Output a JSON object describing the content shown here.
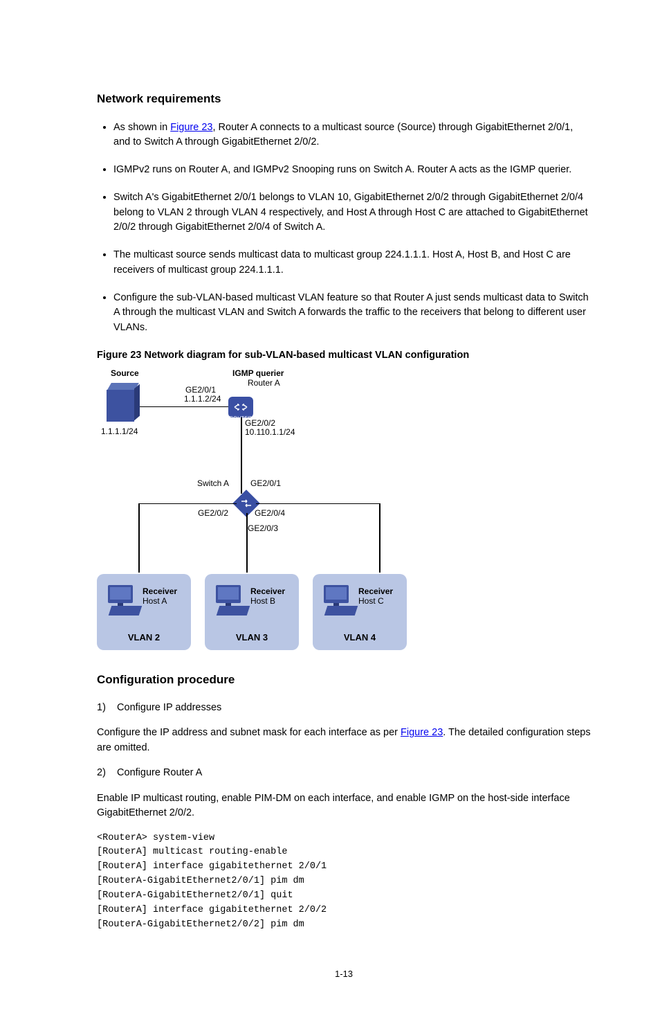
{
  "section1": {
    "title": "Network requirements",
    "bullets": [
      {
        "pre": "As shown in ",
        "link": "Figure 23",
        "post": ", Router A connects to a multicast source (Source) through GigabitEthernet 2/0/1, and to Switch A through GigabitEthernet 2/0/2."
      },
      {
        "text": "IGMPv2 runs on Router A, and IGMPv2 Snooping runs on Switch A. Router A acts as the IGMP querier."
      },
      {
        "text": "Switch A's GigabitEthernet 2/0/1 belongs to VLAN 10, GigabitEthernet 2/0/2 through GigabitEthernet 2/0/4 belong to VLAN 2 through VLAN 4 respectively, and Host A through Host C are attached to GigabitEthernet 2/0/2 through GigabitEthernet 2/0/4 of Switch A."
      },
      {
        "text": "The multicast source sends multicast data to multicast group 224.1.1.1. Host A, Host B, and Host C are receivers of multicast group 224.1.1.1."
      },
      {
        "text": "Configure the sub-VLAN-based multicast VLAN feature so that Router A just sends multicast data to Switch A through the multicast VLAN and Switch A forwards the traffic to the receivers that belong to different user VLANs."
      }
    ]
  },
  "figure": {
    "caption": "Figure 23 Network diagram for sub-VLAN-based multicast VLAN configuration",
    "source_label": "Source",
    "source_ip": "1.1.1.1/24",
    "igmp_label": "IGMP querier",
    "router_label": "Router A",
    "router_if1": "GE2/0/1",
    "router_if1_ip": "1.1.1.2/24",
    "router_if2": "GE2/0/2",
    "router_if2_ip": "10.110.1.1/24",
    "switch_label": "Switch A",
    "switch_if1": "GE2/0/1",
    "switch_if2": "GE2/0/2",
    "switch_if3": "GE2/0/3",
    "switch_if4": "GE2/0/4",
    "receiver": "Receiver",
    "hostA": "Host A",
    "hostB": "Host B",
    "hostC": "Host C",
    "vlan2": "VLAN 2",
    "vlan3": "VLAN 3",
    "vlan4": "VLAN 4"
  },
  "section2": {
    "title": "Configuration procedure",
    "step1_label": "1)",
    "step1_text": "Configure IP addresses",
    "step1_body_pre": "Configure the IP address and subnet mask for each interface as per ",
    "step1_body_link": "Figure 23",
    "step1_body_post": ". The detailed configuration steps are omitted.",
    "step2_label": "2)",
    "step2_text": "Configure Router A",
    "step2_body": "Enable IP multicast routing, enable PIM-DM on each interface, and enable IGMP on the host-side interface GigabitEthernet 2/0/2.",
    "cmds": [
      "<RouterA> system-view",
      "[RouterA] multicast routing-enable",
      "[RouterA] interface gigabitethernet 2/0/1",
      "[RouterA-GigabitEthernet2/0/1] pim dm",
      "[RouterA-GigabitEthernet2/0/1] quit",
      "[RouterA] interface gigabitethernet 2/0/2",
      "[RouterA-GigabitEthernet2/0/2] pim dm"
    ]
  },
  "page_number": "1-13"
}
